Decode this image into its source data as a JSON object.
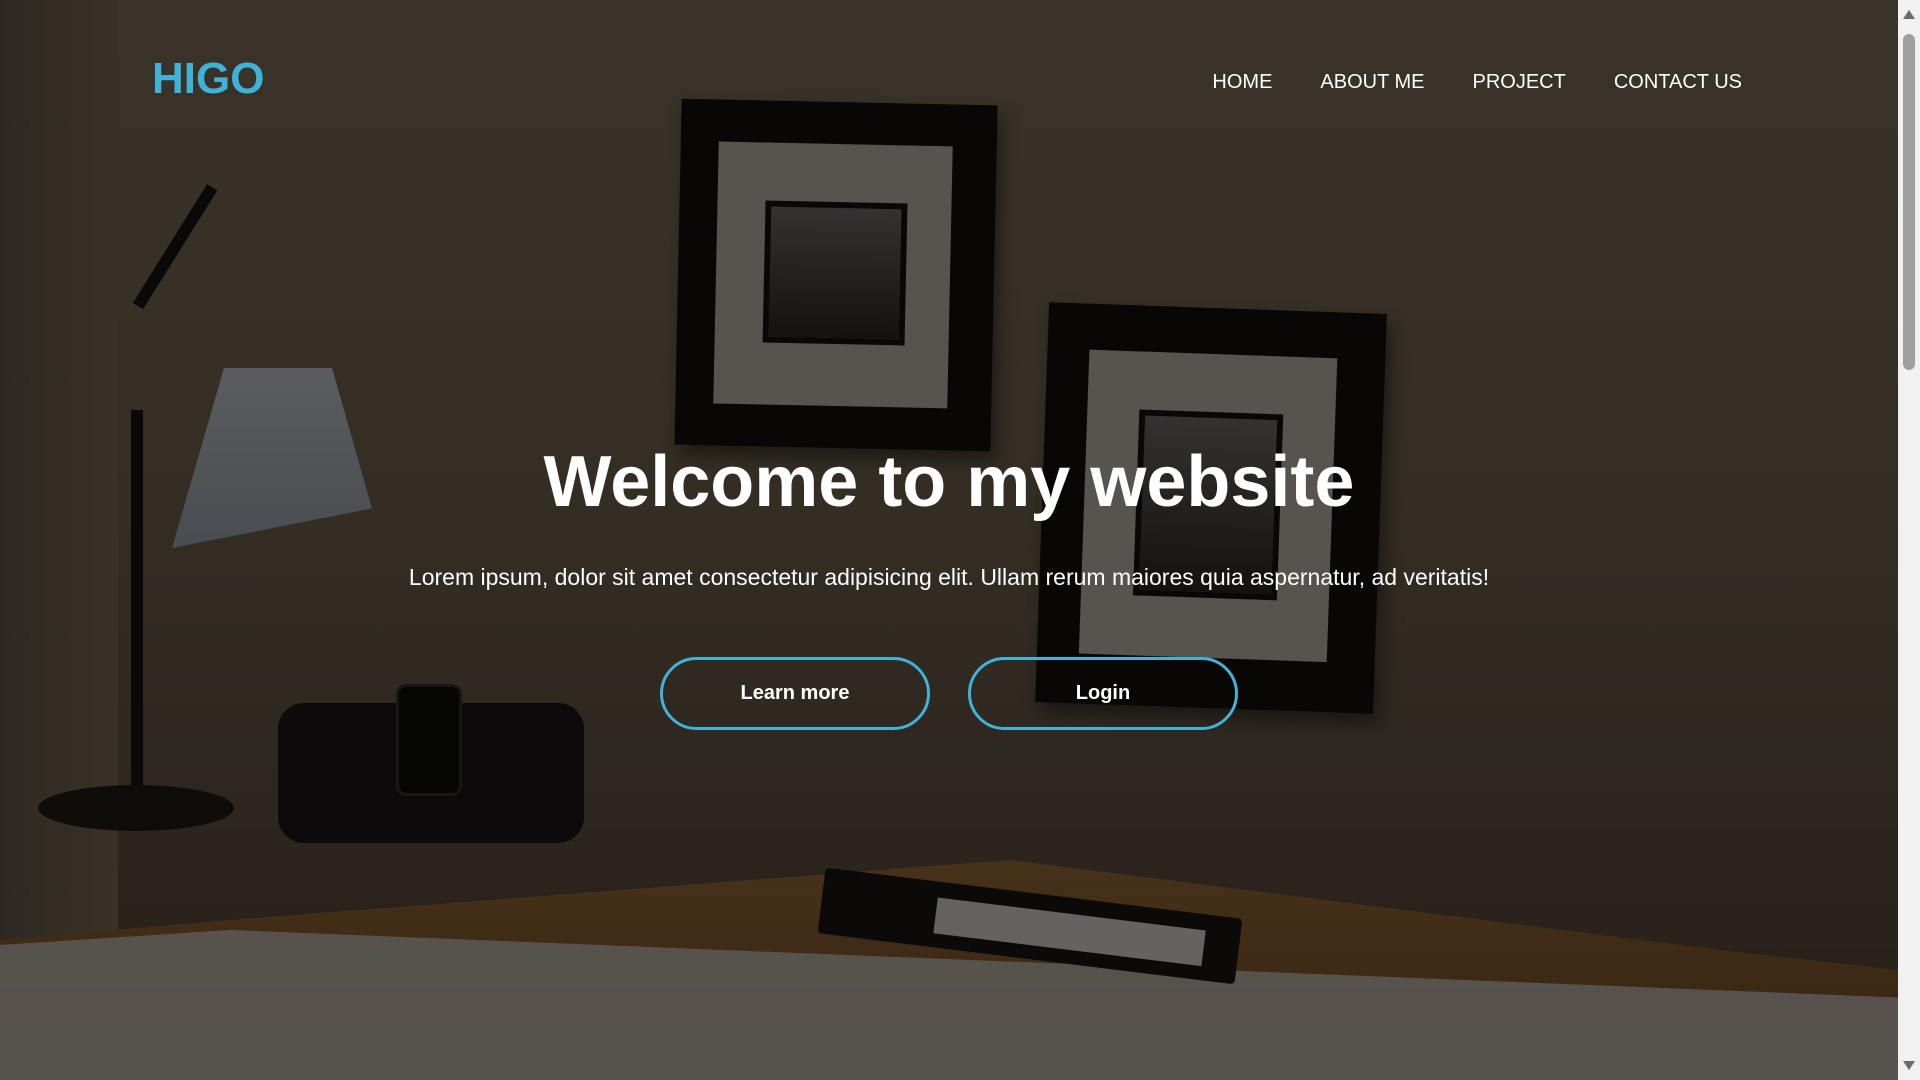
{
  "brand": {
    "logo": "HIGO",
    "accent_color": "#3fb2d8"
  },
  "nav": {
    "items": [
      {
        "label": "HOME"
      },
      {
        "label": "ABOUT ME"
      },
      {
        "label": "PROJECT"
      },
      {
        "label": "CONTACT US"
      }
    ]
  },
  "hero": {
    "title": "Welcome to my website",
    "subtitle": "Lorem ipsum, dolor sit amet consectetur adipisicing elit. Ullam rerum maiores quia aspernatur, ad veritatis!",
    "buttons": {
      "learn_more": "Learn more",
      "login": "Login"
    },
    "button_border_color": "#41b3d6"
  },
  "background": {
    "icon": "office-desk-photo",
    "overlay": "dark"
  },
  "scrollbar": {
    "up_icon": "arrow-up-icon",
    "down_icon": "arrow-down-icon"
  }
}
